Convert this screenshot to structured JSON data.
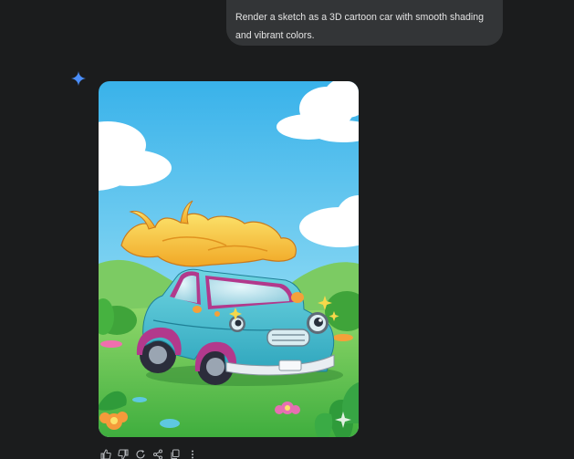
{
  "user_message": {
    "text": "Render a sketch as a 3D cartoon car with smooth shading and vibrant colors."
  },
  "assistant": {
    "avatar_icon": "gemini-spark-icon",
    "spark_color": "#4a8df8",
    "image": {
      "subject": "3D cartoon car",
      "colors": {
        "car_body": "#48c1d2",
        "roof_flame": "#f7c437",
        "trim": "#b2398c",
        "sky": "#5cc3ee",
        "grass": "#4fbb4a"
      }
    },
    "actions": [
      "thumbs-up-icon",
      "thumbs-down-icon",
      "regenerate-icon",
      "share-icon",
      "copy-icon",
      "more-vert-icon"
    ]
  }
}
